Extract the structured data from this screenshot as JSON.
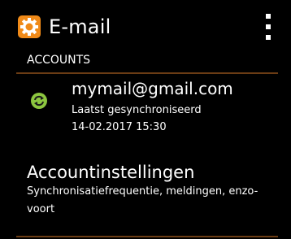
{
  "action_bar": {
    "title": "E-mail",
    "app_icon": "settings-gear-icon",
    "menu_icon": "overflow-menu-icon"
  },
  "accounts": {
    "section_header": "ACCOUNTS",
    "items": [
      {
        "email": "mymail@gmail.com",
        "sync_label": "Laatst gesynchroniseerd",
        "sync_time": "14-02.2017 15:30",
        "icon": "sync-icon"
      }
    ]
  },
  "settings": {
    "title": "Accountinstellingen",
    "description": "Synchronisatiefrequentie, meldingen, enzo-voort"
  },
  "colors": {
    "background": "#000000",
    "accent": "#f08a18",
    "divider": "#6b3c14",
    "sync_green": "#8cc63f",
    "text": "#ffffff"
  }
}
